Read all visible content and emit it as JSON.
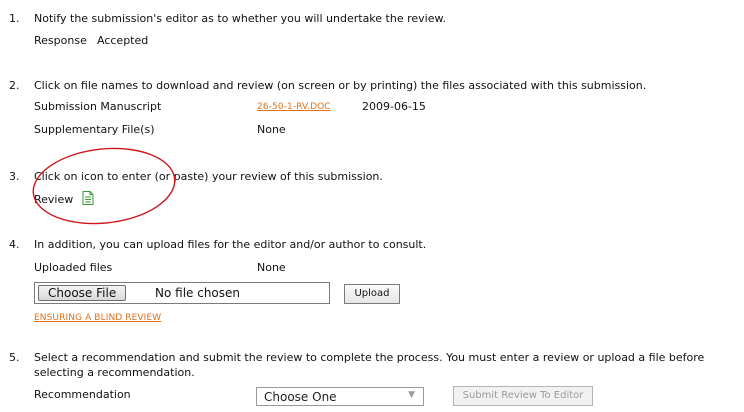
{
  "steps": [
    {
      "number": "1.",
      "text": "Notify the submission's editor as to whether you will undertake the review.",
      "response_label": "Response",
      "response_value": "Accepted"
    },
    {
      "number": "2.",
      "text": "Click on file names to download and review (on screen or by printing) the files associated with this submission.",
      "manuscript_label": "Submission Manuscript",
      "manuscript_file": "26-50-1-RV.DOC",
      "manuscript_date": "2009-06-15",
      "supp_label": "Supplementary File(s)",
      "supp_value": "None"
    },
    {
      "number": "3.",
      "text": "Click on icon to enter (or paste) your review of this submission.",
      "review_label": "Review",
      "review_icon": "document-icon"
    },
    {
      "number": "4.",
      "text": "In addition, you can upload files for the editor and/or author to consult.",
      "uploaded_label": "Uploaded files",
      "uploaded_value": "None",
      "choose_file_label": "Choose File",
      "no_file_text": "No file chosen",
      "upload_label": "Upload",
      "blind_review_link": "ENSURING A BLIND REVIEW"
    },
    {
      "number": "5.",
      "text_line1": "Select a recommendation and submit the review to complete the process. You must enter a review or upload a file before",
      "text_line2": "selecting a recommendation.",
      "recommendation_label": "Recommendation",
      "select_value": "Choose One",
      "submit_label": "Submit Review To Editor"
    }
  ],
  "colors": {
    "link": "#e0701a",
    "annotation": "#d0141c",
    "icon_green": "#3a9a3a"
  }
}
